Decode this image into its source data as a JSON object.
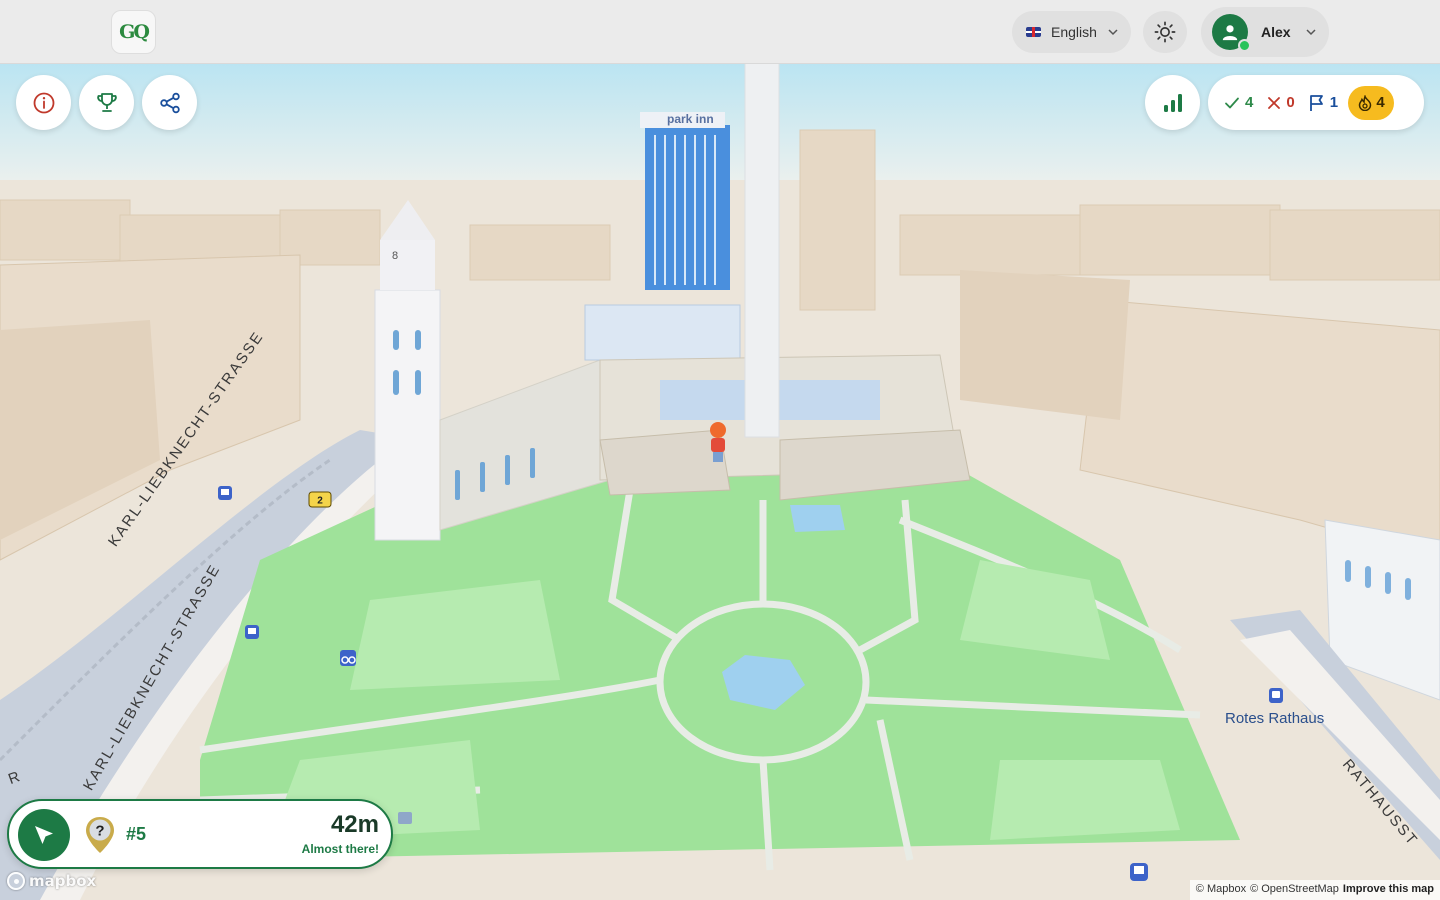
{
  "header": {
    "logo_text": "GQ",
    "language": {
      "flag_icon": "uk-flag-icon",
      "label": "English"
    },
    "theme_icon": "sun-icon",
    "user": {
      "name": "Alex",
      "status": "online"
    }
  },
  "toolbar": {
    "info_icon": "info-icon",
    "leaderboard_icon": "trophy-icon",
    "share_icon": "share-icon",
    "stats_icon": "bar-chart-icon"
  },
  "score": {
    "correct": "4",
    "wrong": "0",
    "flags": "1",
    "streak": "4"
  },
  "target": {
    "number": "#5",
    "distance": "42m",
    "hint": "Almost there!"
  },
  "map": {
    "street_labels": [
      "KARL-LIEBKNECHT-STRASSE",
      "KARL-LIEBKNECHT-STRASSE",
      "RATHAUSST",
      "R"
    ],
    "place_label": "Rotes Rathaus",
    "route_badge": "2",
    "building_number": "8",
    "sign_text": "park inn",
    "mapbox_logo": "mapbox",
    "attribution": {
      "mapbox": "© Mapbox",
      "osm": "© OpenStreetMap",
      "improve": "Improve this map"
    },
    "colors": {
      "park": "#9fe29a",
      "building": "#e8dccb",
      "road": "#f3f1ee",
      "water": "#9fd0ef",
      "accent": "#1d7a45",
      "streak": "#f6bb1f"
    }
  }
}
